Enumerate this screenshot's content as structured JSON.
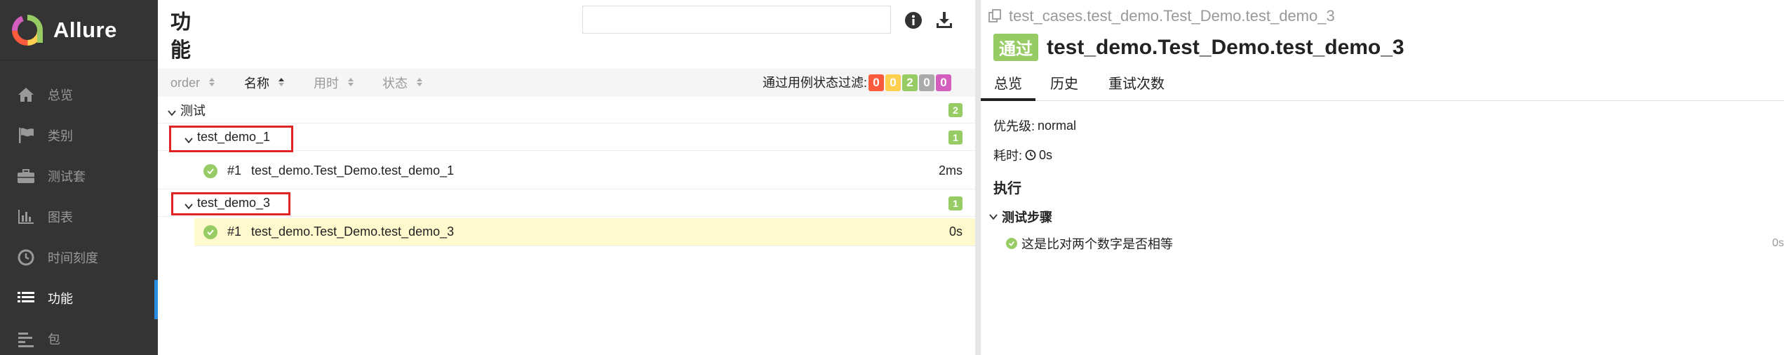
{
  "brand": {
    "name": "Allure"
  },
  "sidebar": {
    "items": [
      {
        "label": "总览",
        "icon": "home-icon"
      },
      {
        "label": "类别",
        "icon": "flag-icon"
      },
      {
        "label": "测试套",
        "icon": "briefcase-icon"
      },
      {
        "label": "图表",
        "icon": "bar-chart-icon"
      },
      {
        "label": "时间刻度",
        "icon": "clock-icon"
      },
      {
        "label": "功能",
        "icon": "list-icon",
        "active": true
      },
      {
        "label": "包",
        "icon": "align-left-icon"
      }
    ]
  },
  "main": {
    "title": "功能",
    "search": {
      "value": "",
      "placeholder": ""
    },
    "sort_columns": [
      "order",
      "名称",
      "用时",
      "状态"
    ],
    "active_sort": "名称",
    "filter_label": "通过用例状态过滤:",
    "status_counts": [
      {
        "value": "0",
        "color": "#fd5a3e"
      },
      {
        "value": "0",
        "color": "#ffd050"
      },
      {
        "value": "2",
        "color": "#97cc64"
      },
      {
        "value": "0",
        "color": "#aaaaaa"
      },
      {
        "value": "0",
        "color": "#d35ebe"
      }
    ],
    "tree": {
      "group": {
        "label": "测试",
        "count": "2"
      },
      "features": [
        {
          "label": "test_demo_1",
          "count": "1",
          "cases": [
            {
              "num": "#1",
              "name": "test_demo.Test_Demo.test_demo_1",
              "time": "2ms",
              "selected": false
            }
          ]
        },
        {
          "label": "test_demo_3",
          "count": "1",
          "cases": [
            {
              "num": "#1",
              "name": "test_demo.Test_Demo.test_demo_3",
              "time": "0s",
              "selected": true
            }
          ]
        }
      ]
    }
  },
  "detail": {
    "full_name": "test_cases.test_demo.Test_Demo.test_demo_3",
    "status": "通过",
    "name": "test_demo.Test_Demo.test_demo_3",
    "tabs": [
      "总览",
      "历史",
      "重试次数"
    ],
    "active_tab": "总览",
    "severity_label": "优先级:",
    "severity_value": "normal",
    "duration_label": "耗时:",
    "duration_value": "0s",
    "execution_title": "执行",
    "steps_title": "测试步骤",
    "steps": [
      {
        "name": "这是比对两个数字是否相等",
        "time": "0s"
      }
    ]
  },
  "colors": {
    "sidebar_bg": "#343434",
    "accent": "#2a8ee0",
    "passed": "#97cc64",
    "selected_row": "#fffacd",
    "highlight_box": "#e02424"
  }
}
